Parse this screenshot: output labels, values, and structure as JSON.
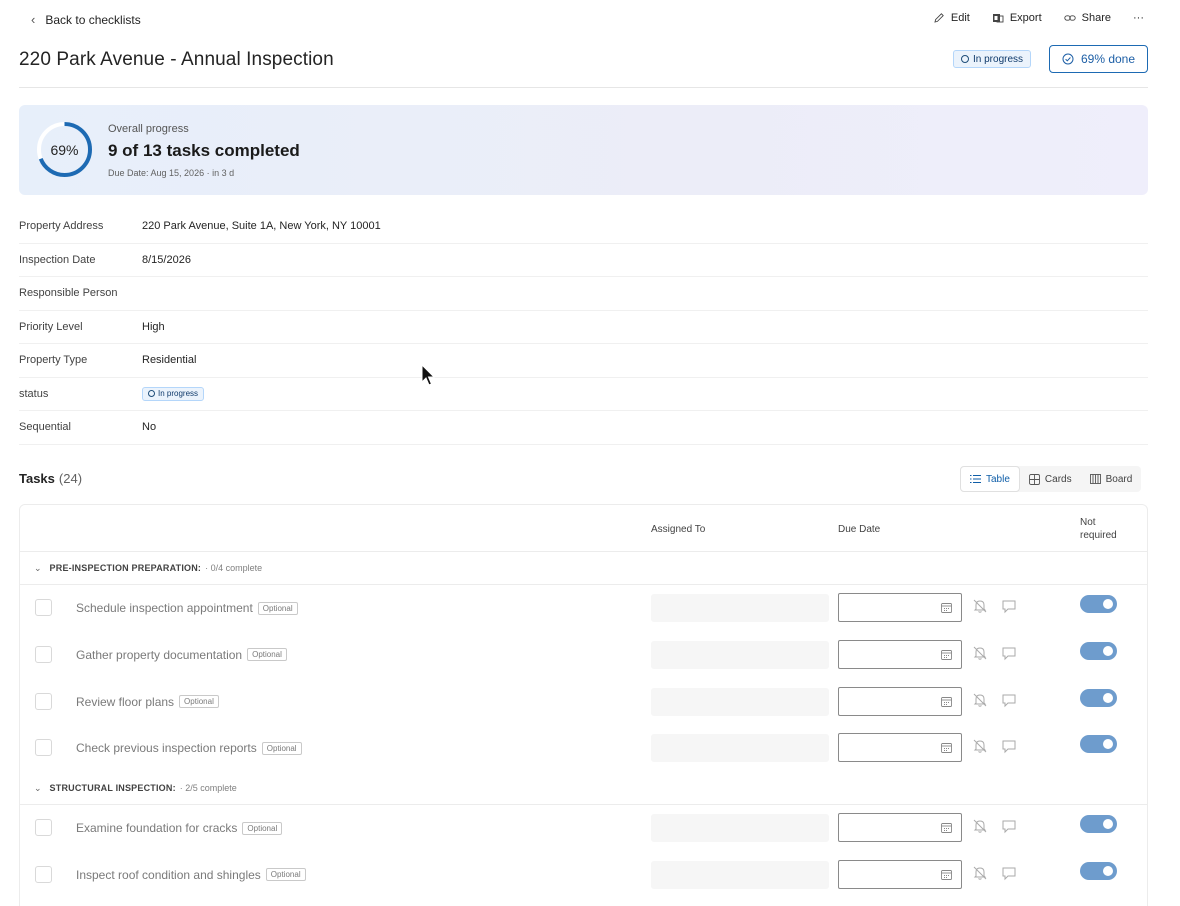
{
  "nav": {
    "back_label": "Back to checklists"
  },
  "actions": {
    "edit": "Edit",
    "export": "Export",
    "share": "Share",
    "more": "···"
  },
  "page": {
    "title": "220 Park Avenue - Annual Inspection",
    "status": "In progress",
    "done_label": "69% done"
  },
  "progress": {
    "percent_label": "69%",
    "percent": 69,
    "label": "Overall progress",
    "summary": "9 of 13 tasks completed",
    "due": "Due Date: Aug 15, 2026 · in 3 d"
  },
  "properties": [
    {
      "key": "Property Address",
      "value": "220 Park Avenue, Suite 1A, New York, NY 10001"
    },
    {
      "key": "Inspection Date",
      "value": "8/15/2026"
    },
    {
      "key": "Responsible Person",
      "value": ""
    },
    {
      "key": "Priority Level",
      "value": "High"
    },
    {
      "key": "Property Type",
      "value": "Residential"
    },
    {
      "key": "status",
      "value": "In progress"
    },
    {
      "key": "Sequential",
      "value": "No"
    }
  ],
  "tasks": {
    "title": "Tasks",
    "count": "(24)",
    "views": [
      "Table",
      "Cards",
      "Board"
    ],
    "columns": {
      "assigned": "Assigned To",
      "due": "Due Date",
      "not_required_1": "Not",
      "not_required_2": "required"
    },
    "groups": [
      {
        "name": "PRE-INSPECTION PREPARATION:",
        "count": "· 0/4 complete",
        "items": [
          {
            "name": "Schedule inspection appointment",
            "badge": "Optional"
          },
          {
            "name": "Gather property documentation",
            "badge": "Optional"
          },
          {
            "name": "Review floor plans",
            "badge": "Optional"
          },
          {
            "name": "Check previous inspection reports",
            "badge": "Optional"
          }
        ]
      },
      {
        "name": "STRUCTURAL INSPECTION:",
        "count": "· 2/5 complete",
        "items": [
          {
            "name": "Examine foundation for cracks",
            "badge": "Optional"
          },
          {
            "name": "Inspect roof condition and shingles",
            "badge": "Optional"
          }
        ]
      }
    ]
  },
  "colors": {
    "accent": "#1d6ab3",
    "toggle": "#6e9ccd",
    "pill_bg": "#ebf3fc"
  }
}
